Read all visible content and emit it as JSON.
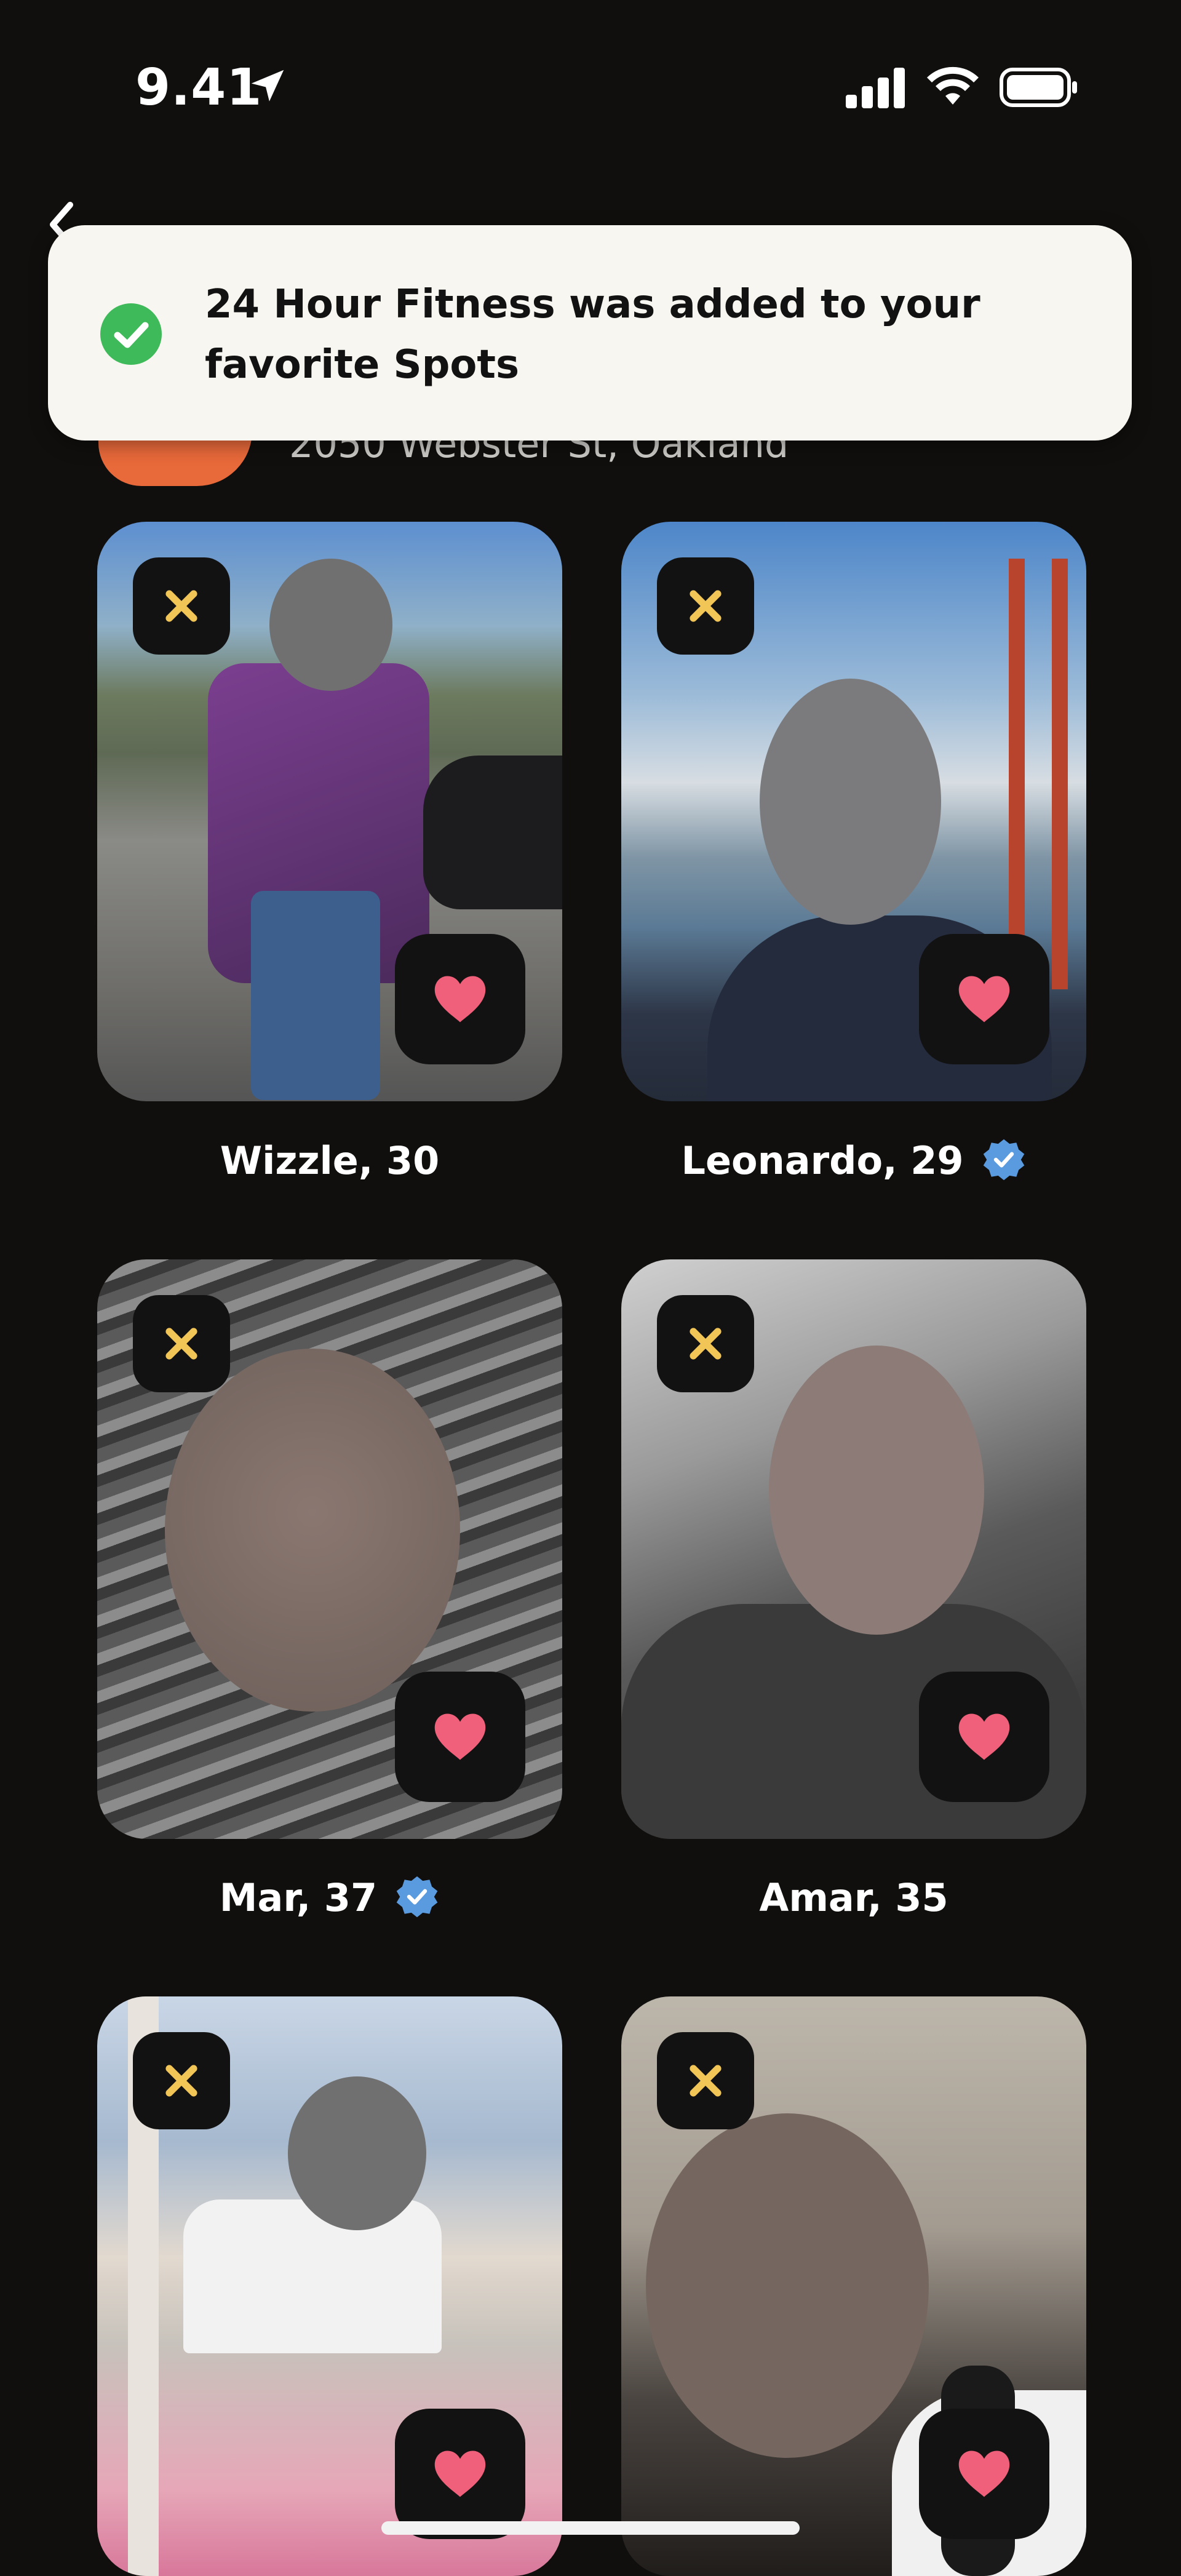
{
  "status_bar": {
    "time": "9.41"
  },
  "spot": {
    "address": "2050 Webster St, Oakland",
    "logo_color": "#e8693a"
  },
  "toast": {
    "message": "24 Hour Fitness was added to your favorite Spots",
    "accent": "#3fba5a"
  },
  "accent": {
    "heart": "#f0607a",
    "dismiss": "#f2c557",
    "verified": "#5a9be0"
  },
  "profiles": [
    {
      "name_age": "Wizzle, 30",
      "verified": false
    },
    {
      "name_age": "Leonardo, 29",
      "verified": true
    },
    {
      "name_age": "Mar, 37",
      "verified": true
    },
    {
      "name_age": "Amar, 35",
      "verified": false
    },
    {
      "name_age": "",
      "verified": false
    },
    {
      "name_age": "",
      "verified": false
    }
  ]
}
